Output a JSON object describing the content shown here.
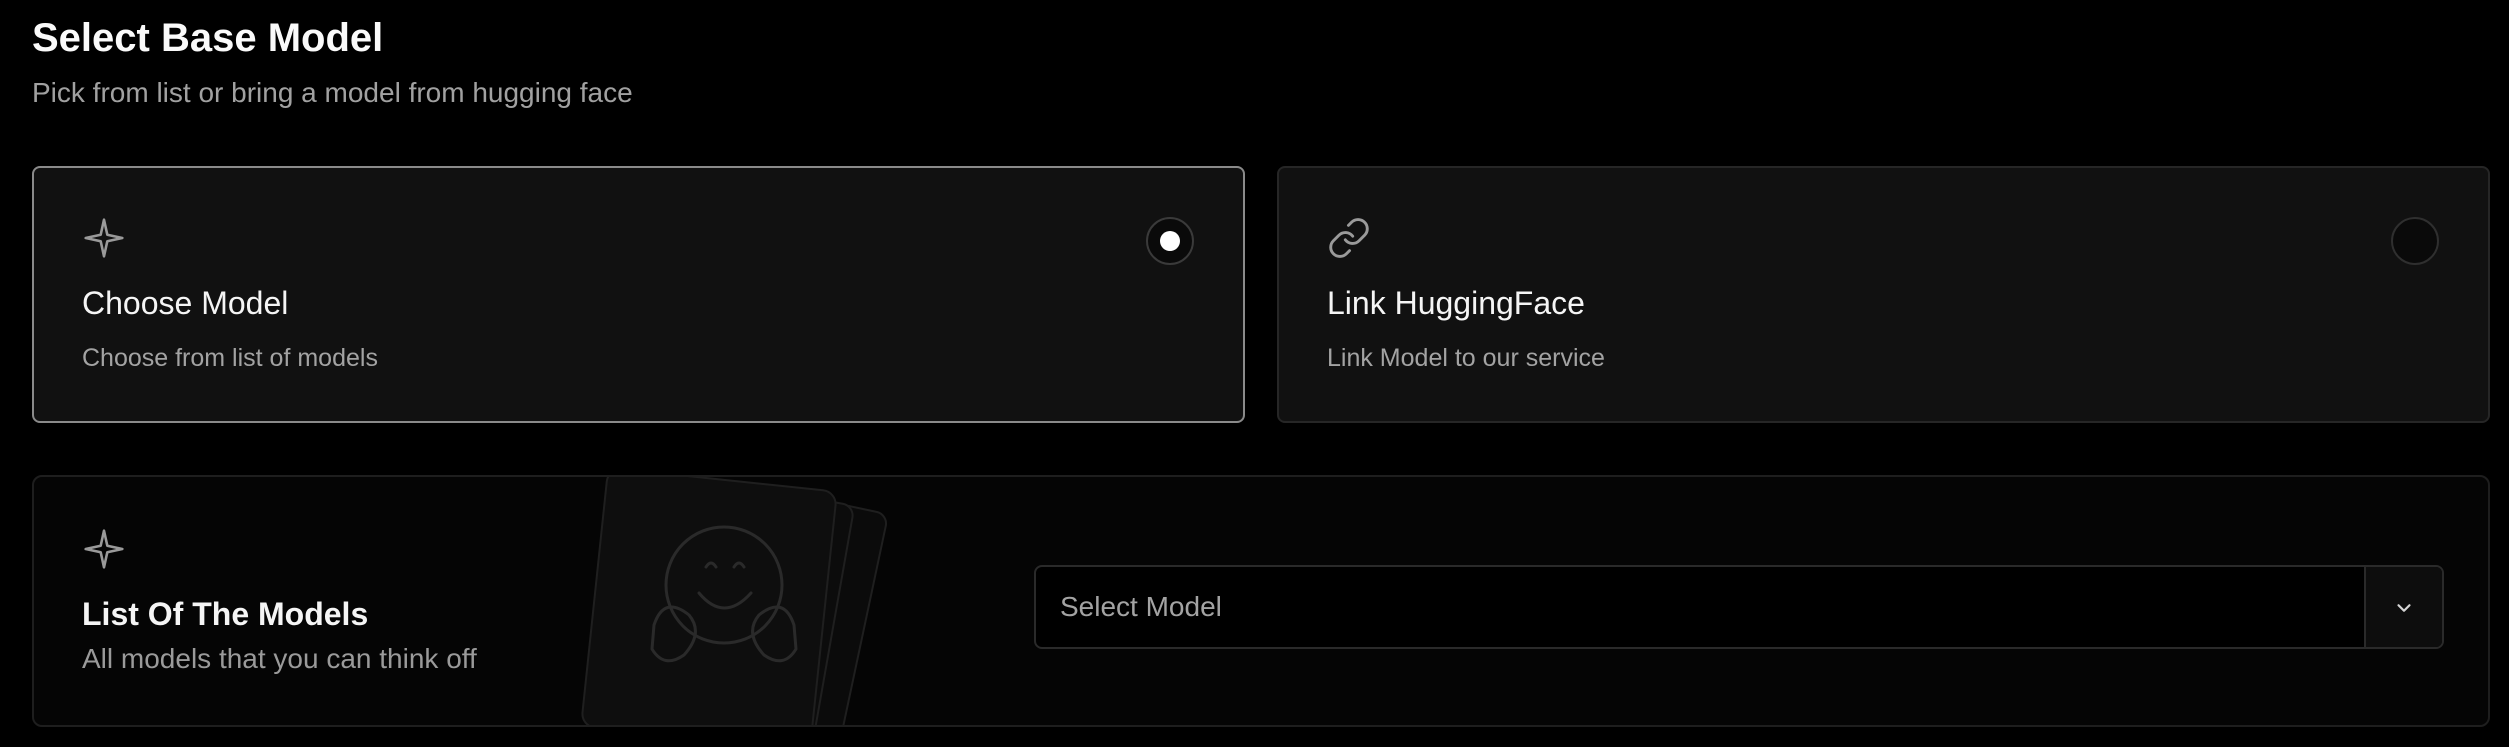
{
  "header": {
    "title": "Select Base Model",
    "subtitle": "Pick from list or bring a model from hugging face"
  },
  "options": [
    {
      "title": "Choose Model",
      "description": "Choose from list of models",
      "icon": "sparkle-icon",
      "selected": true
    },
    {
      "title": "Link HuggingFace",
      "description": "Link Model to our service",
      "icon": "link-icon",
      "selected": false
    }
  ],
  "models_panel": {
    "icon": "sparkle-icon",
    "title": "List Of The Models",
    "description": "All models that you can think off",
    "illustration": "hugging-face-emoji-icon",
    "select": {
      "value": "Select Model",
      "icon": "chevron-down-icon"
    }
  },
  "colors": {
    "background": "#000000",
    "card_background": "#111111",
    "selected_border": "#8a8a8a",
    "muted_text": "#a3a3a3"
  }
}
